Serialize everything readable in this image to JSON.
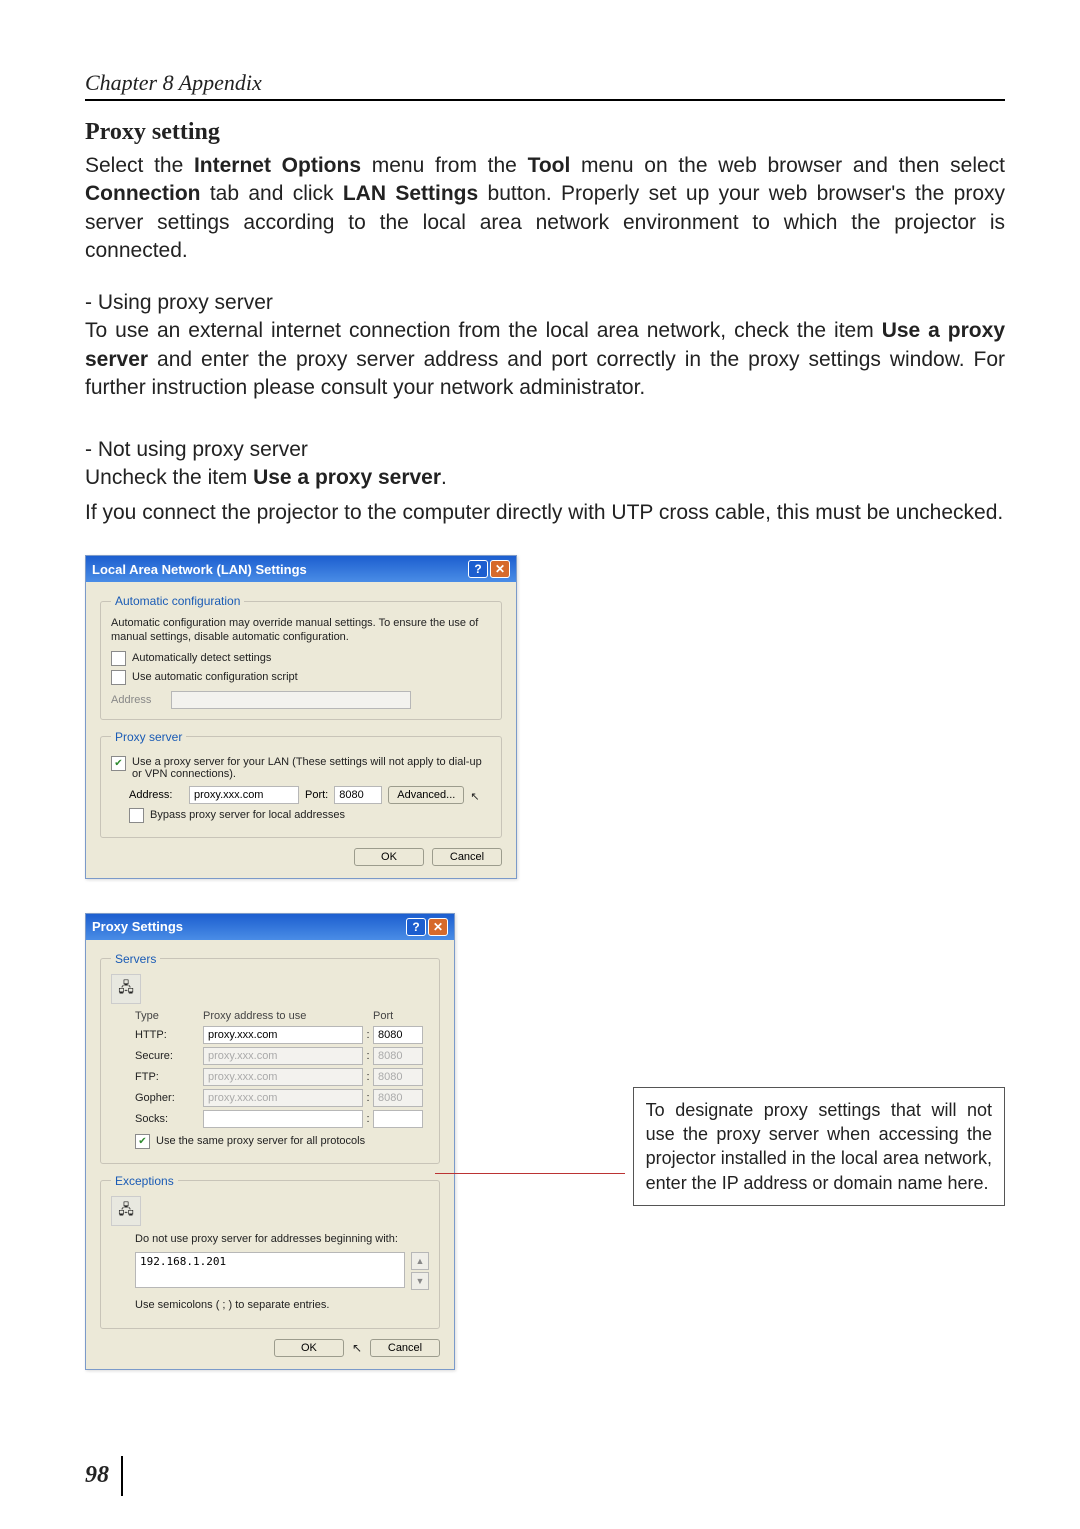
{
  "header": {
    "chapter": "Chapter 8 Appendix"
  },
  "section": {
    "title": "Proxy setting",
    "intro_before_io": "Select the ",
    "io_bold": "Internet Options",
    "intro_mid1": " menu from the ",
    "tool_bold": "Tool",
    "intro_mid2": " menu on the web browser and then select ",
    "conn_bold": "Connection",
    "intro_mid3": " tab and click ",
    "lan_bold": "LAN Settings",
    "intro_after": " button. Properly set up your web browser's the proxy server settings according to the local area network environment to which the projector is connected."
  },
  "using": {
    "heading": "- Using proxy server",
    "para_before": "To use an external internet connection from the local area network, check the item ",
    "bold": "Use a proxy server",
    "para_after": " and enter the proxy server address and port correctly in the proxy settings window. For further instruction please consult your network administrator."
  },
  "notusing": {
    "heading": "- Not using proxy server",
    "line1_before": "Uncheck the item ",
    "line1_bold": "Use a proxy server",
    "line1_after": ".",
    "line2": "If you connect the projector to the computer directly with UTP cross cable, this must be unchecked."
  },
  "dialog1": {
    "title": "Local Area Network (LAN) Settings",
    "auto": {
      "legend": "Automatic configuration",
      "desc": "Automatic configuration may override manual settings. To ensure the use of manual settings, disable automatic configuration.",
      "auto_detect": "Automatically detect settings",
      "use_script": "Use automatic configuration script",
      "address_label": "Address",
      "address_value": ""
    },
    "proxy": {
      "legend": "Proxy server",
      "use_proxy": "Use a proxy server for your LAN (These settings will not apply to dial-up or VPN connections).",
      "address_label": "Address:",
      "address_value": "proxy.xxx.com",
      "port_label": "Port:",
      "port_value": "8080",
      "advanced": "Advanced...",
      "bypass": "Bypass proxy server for local addresses"
    },
    "ok": "OK",
    "cancel": "Cancel"
  },
  "dialog2": {
    "title": "Proxy Settings",
    "servers": {
      "legend": "Servers",
      "col_type": "Type",
      "col_addr": "Proxy address to use",
      "col_port": "Port",
      "rows": [
        {
          "type": "HTTP:",
          "addr": "proxy.xxx.com",
          "port": "8080",
          "disabled": false
        },
        {
          "type": "Secure:",
          "addr": "proxy.xxx.com",
          "port": "8080",
          "disabled": true
        },
        {
          "type": "FTP:",
          "addr": "proxy.xxx.com",
          "port": "8080",
          "disabled": true
        },
        {
          "type": "Gopher:",
          "addr": "proxy.xxx.com",
          "port": "8080",
          "disabled": true
        },
        {
          "type": "Socks:",
          "addr": "",
          "port": "",
          "disabled": false
        }
      ],
      "same": "Use the same proxy server for all protocols"
    },
    "exceptions": {
      "legend": "Exceptions",
      "desc": "Do not use proxy server for addresses beginning with:",
      "value": "192.168.1.201",
      "hint": "Use semicolons ( ; ) to separate entries."
    },
    "ok": "OK",
    "cancel": "Cancel"
  },
  "callout": "To designate proxy settings that will not use the proxy server when accessing the projector installed in the local area network, enter the IP address or domain name here.",
  "page_number": "98",
  "glyphs": {
    "help": "?",
    "close": "✕",
    "up": "▲",
    "down": "▼",
    "cursor": "↖"
  }
}
